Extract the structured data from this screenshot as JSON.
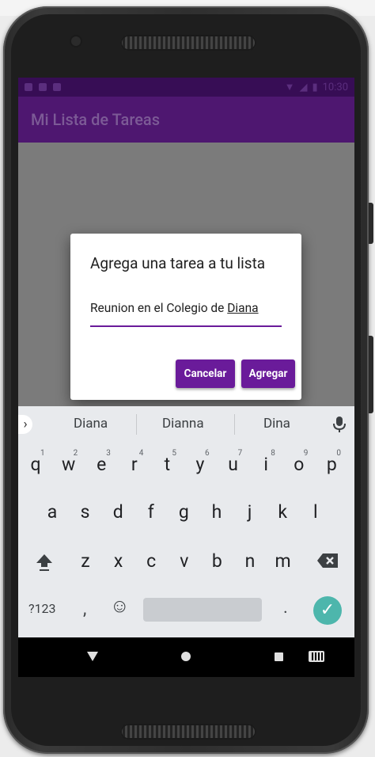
{
  "status_bar": {
    "time": "10:30"
  },
  "app_bar": {
    "title": "Mi Lista de Tareas"
  },
  "dialog": {
    "title": "Agrega una tarea a tu lista",
    "input_value_prefix": "Reunion en el Colegio de ",
    "input_value_underlined": "Diana",
    "cancel_label": "Cancelar",
    "add_label": "Agregar"
  },
  "fab": {
    "label": "+"
  },
  "keyboard": {
    "suggestions": [
      "Diana",
      "Dianna",
      "Dina"
    ],
    "row1": [
      {
        "k": "q",
        "n": "1"
      },
      {
        "k": "w",
        "n": "2"
      },
      {
        "k": "e",
        "n": "3"
      },
      {
        "k": "r",
        "n": "4"
      },
      {
        "k": "t",
        "n": "5"
      },
      {
        "k": "y",
        "n": "6"
      },
      {
        "k": "u",
        "n": "7"
      },
      {
        "k": "i",
        "n": "8"
      },
      {
        "k": "o",
        "n": "9"
      },
      {
        "k": "p",
        "n": "0"
      }
    ],
    "row2": [
      "a",
      "s",
      "d",
      "f",
      "g",
      "h",
      "j",
      "k",
      "l"
    ],
    "row3": [
      "z",
      "x",
      "c",
      "v",
      "b",
      "n",
      "m"
    ],
    "symbols_label": "?123",
    "comma_label": ",",
    "period_label": ".",
    "emoji_label": "☺",
    "enter_label": "✓"
  },
  "colors": {
    "status_bar": "#370d55",
    "app_bar": "#4e1770",
    "accent": "#6a1b9a",
    "scrim": "#7b7b7b",
    "enter_key": "#4db6ac"
  }
}
